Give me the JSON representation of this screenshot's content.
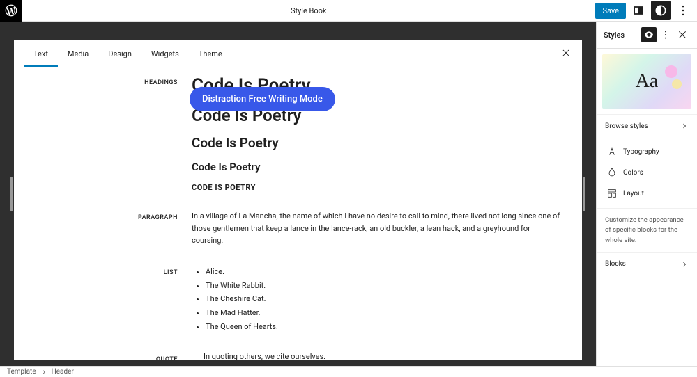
{
  "header": {
    "title": "Style Book",
    "save": "Save"
  },
  "pill": "Distraction Free Writing Mode",
  "tabs": [
    "Text",
    "Media",
    "Design",
    "Widgets",
    "Theme"
  ],
  "active_tab": 0,
  "sections": {
    "headings": {
      "label": "HEADINGS",
      "h1": "Code Is Poetry",
      "h2": "Code Is Poetry",
      "h3": "Code Is Poetry",
      "h4": "Code Is Poetry",
      "h5": "CODE IS POETRY"
    },
    "paragraph": {
      "label": "PARAGRAPH",
      "text": "In a village of La Mancha, the name of which I have no desire to call to mind, there lived not long since one of those gentlemen that keep a lance in the lance-rack, an old buckler, a lean hack, and a greyhound for coursing."
    },
    "list": {
      "label": "LIST",
      "items": [
        "Alice.",
        "The White Rabbit.",
        "The Cheshire Cat.",
        "The Mad Hatter.",
        "The Queen of Hearts."
      ]
    },
    "quote": {
      "label": "QUOTE",
      "text": "In quoting others, we cite ourselves."
    }
  },
  "sidebar": {
    "title": "Styles",
    "preview_text": "Aa",
    "browse": "Browse styles",
    "items": [
      {
        "label": "Typography",
        "icon": "typography"
      },
      {
        "label": "Colors",
        "icon": "colors"
      },
      {
        "label": "Layout",
        "icon": "layout"
      }
    ],
    "desc": "Customize the appearance of specific blocks for the whole site.",
    "blocks": "Blocks"
  },
  "footer": {
    "crumb1": "Template",
    "crumb2": "Header"
  }
}
